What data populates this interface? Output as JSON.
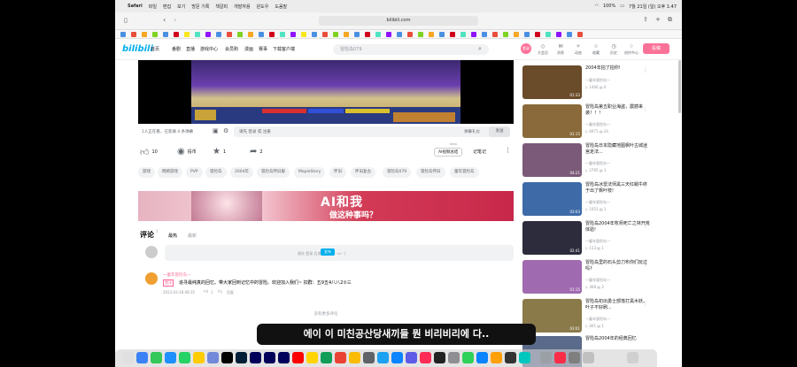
{
  "menubar": {
    "apple": "",
    "app": "Safari",
    "items": [
      "파일",
      "편집",
      "보기",
      "방문 기록",
      "책갈피",
      "개발자용",
      "윈도우",
      "도움말"
    ],
    "battery": "100%",
    "datetime": "7월 21일 (일) 오후 1:47"
  },
  "browser": {
    "url": "bilibili.com"
  },
  "header": {
    "logo": "bilibili",
    "nav": [
      "首页",
      "番剧",
      "直播",
      "游戏中心",
      "会员购",
      "漫画",
      "赛事",
      "下载客户端"
    ],
    "search_placeholder": "冒险岛079",
    "avatar": "登录",
    "icons": [
      {
        "label": "大会员",
        "glyph": "◇"
      },
      {
        "label": "消息",
        "glyph": "✉"
      },
      {
        "label": "动态",
        "glyph": "✧"
      },
      {
        "label": "收藏",
        "glyph": "☆"
      },
      {
        "label": "历史",
        "glyph": "◷"
      },
      {
        "label": "创作中心",
        "glyph": "♢"
      }
    ],
    "upload": "投稿"
  },
  "player": {
    "watching": "1人正在看，已装填 4 条弹幕",
    "danmaku_placeholder": "请先 登录 或 注册",
    "etiquette": "弹幕礼仪",
    "send": "发送"
  },
  "actions": {
    "like": "10",
    "coin": "投币",
    "fav": "1",
    "share": "2",
    "ai": "AI视频总结",
    "note": "记笔记",
    "ai_badge": "beta"
  },
  "tags": [
    "游戏",
    "网络游戏",
    "PVP",
    "冒险岛",
    "2004年",
    "冒险岛怀旧服",
    "MapleStory",
    "怀旧",
    "怀旧复古",
    "冒险岛079",
    "冒险岛怀旧",
    "童年冒险岛"
  ],
  "banner": {
    "line1": "AI和我",
    "line2": "做这种事吗？"
  },
  "comments": {
    "title": "评论",
    "count": "1",
    "sort_hot": "最热",
    "sort_new": "最新",
    "box_text": "请先 登录 后发表评论 (・ω・)",
    "box_btn": "发布",
    "c1_user": "一童年冒险岛一",
    "c1_tag": "置顶",
    "c1_text": "追寻最纯真的回忆。带大家回到记忆中的冒险。欢迎加入我们~ 扣群：五9五4八八2②三",
    "c1_time": "2023-03-18 08:35",
    "c1_like": "1",
    "c1_reply": "回复",
    "more": "没有更多评论"
  },
  "related": [
    {
      "title": "2004年拍了拍你!",
      "up": "一童年冒险岛一",
      "plays": "1400",
      "comments": "0",
      "dur": "01:33",
      "color": "#6a4b2a"
    },
    {
      "title": "冒险岛第五职业海盗，震撼来袭！！！",
      "up": "一童年冒险岛一",
      "plays": "6971",
      "comments": "24",
      "dur": "01:15",
      "color": "#8a6a3a"
    },
    {
      "title": "冒险岛日本隐藏地图枫叶古城迷宫走法...",
      "up": "一童年冒险岛一",
      "plays": "2795",
      "comments": "1",
      "dur": "04:21",
      "color": "#7a5a78"
    },
    {
      "title": "冒险岛冰雷法师黑三天红蜗牛终于出了枫叶枝!",
      "up": "一童年冒险岛一",
      "plays": "1053",
      "comments": "1",
      "dur": "03:03",
      "color": "#3e6aa8"
    },
    {
      "title": "冒险岛2004年牧师死亡之林开荒体验!",
      "up": "一童年冒险岛一",
      "plays": "113",
      "comments": "1",
      "dur": "02:41",
      "color": "#2c2c3c"
    },
    {
      "title": "冒险岛里的石头剪刀布你们玩过吗?",
      "up": "一童年冒险岛一",
      "plays": "368",
      "comments": "2",
      "dur": "01:15",
      "color": "#a06ab0"
    },
    {
      "title": "冒险岛初出勇士部落打黑木妖。叶子不好刷...",
      "up": "一童年冒险岛一",
      "plays": "401",
      "comments": "1",
      "dur": "03:01",
      "color": "#8a7a4a"
    },
    {
      "title": "冒险岛2004年的经典回忆",
      "up": "",
      "plays": "",
      "comments": "",
      "dur": "",
      "color": "#5a6a8a"
    }
  ],
  "subtitle": "에이 이 미친공산당새끼들 뭔 비리비리에 다.."
}
